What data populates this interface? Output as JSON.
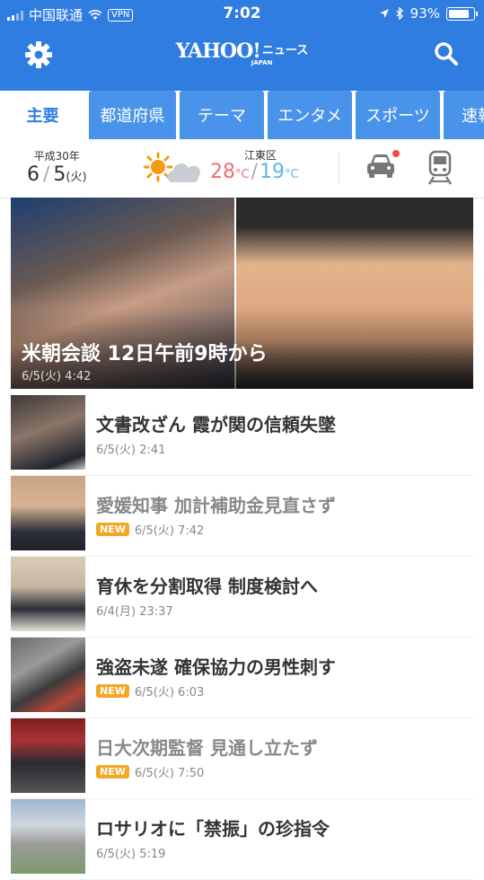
{
  "status": {
    "carrier": "中国联通",
    "vpn": "VPN",
    "time": "7:02",
    "battery": "93%",
    "battery_level": 0.93
  },
  "header": {
    "logo_main": "YAHOO!",
    "logo_news": "ニュース",
    "logo_sub": "JAPAN"
  },
  "tabs": [
    "主要",
    "都道府県",
    "テーマ",
    "エンタメ",
    "スポーツ",
    "速報"
  ],
  "info": {
    "era": "平成30年",
    "month": "6",
    "day": "5",
    "weekday": "(火)",
    "location": "江東区",
    "high": "28",
    "low": "19",
    "unit": "°C"
  },
  "hero": {
    "title": "米朝会談 12日午前9時から",
    "time": "6/5(火) 4:42"
  },
  "articles": [
    {
      "title": "文書改ざん 霞が関の信頼失墜",
      "time": "6/5(火) 2:41",
      "new": ""
    },
    {
      "title": "愛媛知事 加計補助金見直さず",
      "time": "6/5(火) 7:42",
      "new": "NEW"
    },
    {
      "title": "育休を分割取得 制度検討へ",
      "time": "6/4(月) 23:37",
      "new": ""
    },
    {
      "title": "強盗未遂 確保協力の男性刺す",
      "time": "6/5(火) 6:03",
      "new": "NEW"
    },
    {
      "title": "日大次期監督 見通し立たず",
      "time": "6/5(火) 7:50",
      "new": "NEW"
    },
    {
      "title": "ロサリオに「禁振」の珍指令",
      "time": "6/5(火) 5:19",
      "new": ""
    }
  ],
  "colors": {
    "brand": "#2f7de1",
    "tab": "#4a93ea",
    "new_badge": "#f5a623",
    "high_temp": "#ef6e6e",
    "low_temp": "#5fb4e8"
  }
}
